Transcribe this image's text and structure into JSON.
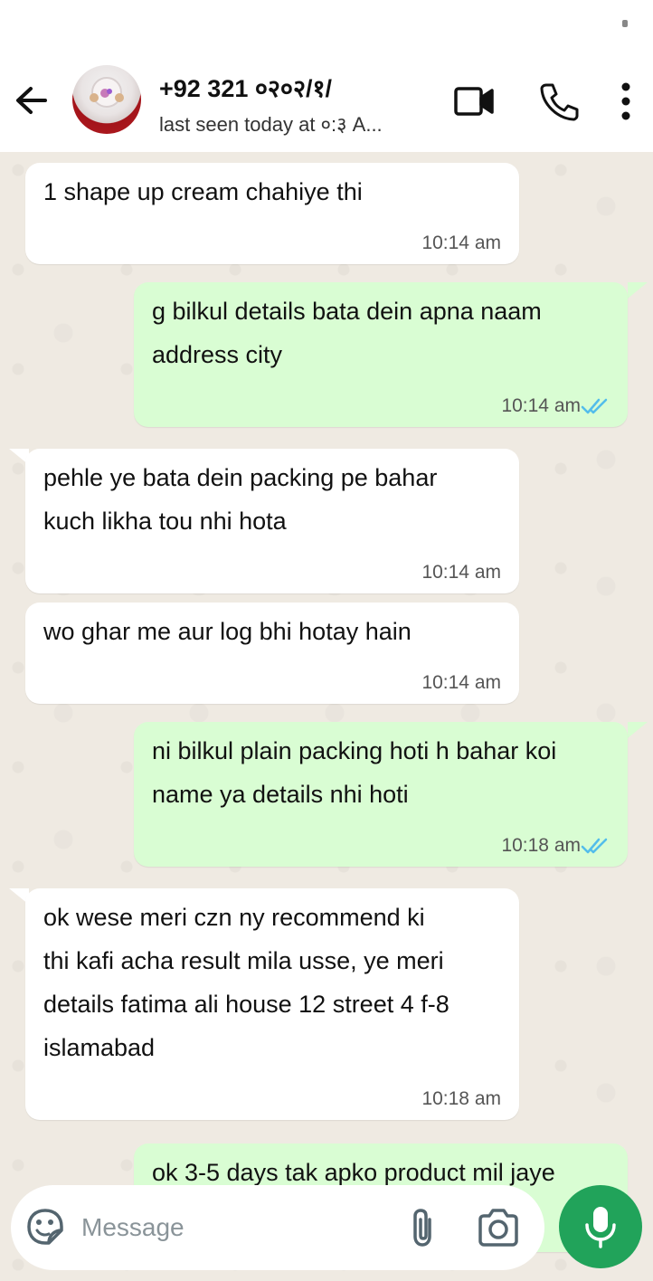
{
  "header": {
    "contact_name": "+92 321 ०२०२/१/",
    "status": "last seen today at ०:३ A..."
  },
  "messages": [
    {
      "direction": "in",
      "text": "1 shape up cream chahiye thi",
      "time": "10:14 am"
    },
    {
      "direction": "out",
      "text": "g bilkul details bata dein apna naam\naddress city",
      "time": "10:14 am",
      "read": true
    },
    {
      "direction": "in",
      "text": "pehle ye bata dein packing pe bahar\nkuch likha tou nhi hota",
      "time": "10:14 am"
    },
    {
      "direction": "in",
      "text": "wo ghar me aur log bhi hotay hain",
      "time": "10:14 am"
    },
    {
      "direction": "out",
      "text": "ni bilkul plain packing hoti h bahar koi\nname ya details nhi hoti",
      "time": "10:18 am",
      "read": true
    },
    {
      "direction": "in",
      "text": "ok wese meri czn ny recommend ki\nthi kafi acha result mila usse, ye meri\ndetails fatima ali house 12 street 4 f-8\nislamabad",
      "time": "10:18 am"
    },
    {
      "direction": "out",
      "text": "ok 3-5 days tak apko product mil jaye",
      "time": "",
      "partial": true
    }
  ],
  "input": {
    "placeholder": "Message",
    "value": ""
  },
  "colors": {
    "incoming_bubble": "#ffffff",
    "outgoing_bubble": "#d9fdd3",
    "chat_background": "#efeae2",
    "read_ticks": "#53bdeb",
    "mic_button": "#21a35a"
  },
  "icons": {
    "back": "arrow-left-icon",
    "video": "video-camera-icon",
    "call": "phone-icon",
    "menu": "more-vertical-icon",
    "emoji": "emoji-sticker-icon",
    "attach": "paperclip-icon",
    "camera": "camera-icon",
    "mic": "microphone-icon"
  }
}
